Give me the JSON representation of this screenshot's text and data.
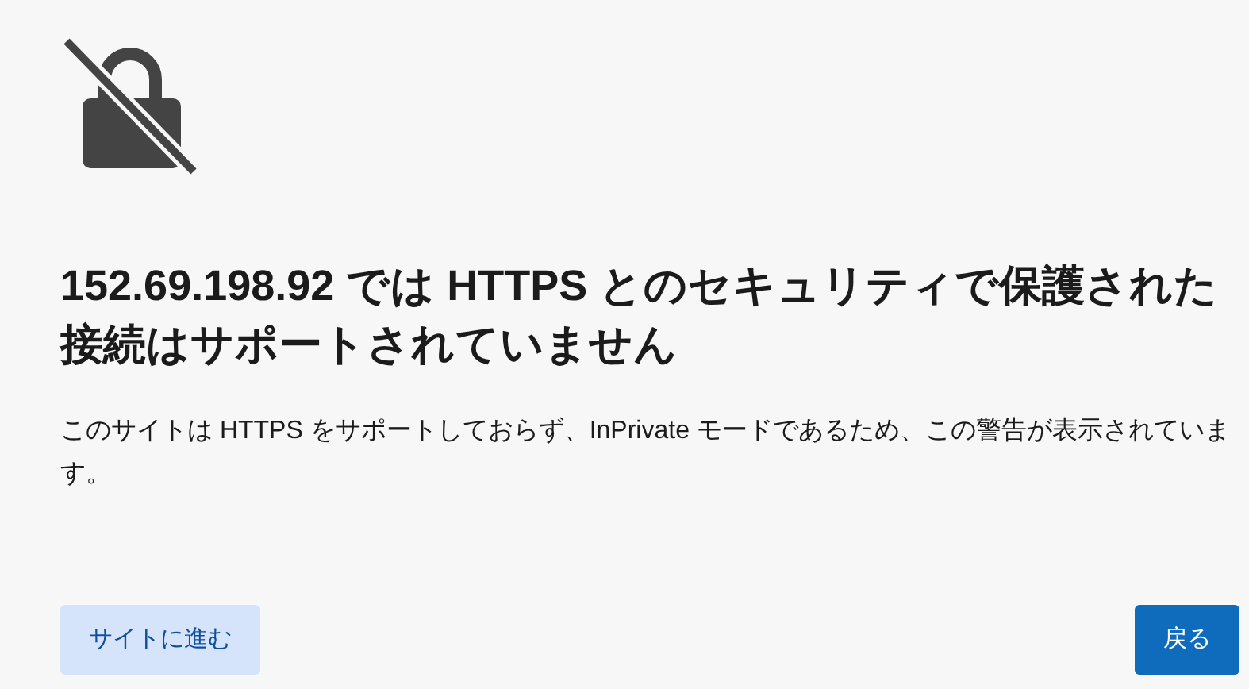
{
  "heading": "152.69.198.92 では HTTPS とのセキュリティで保護された接続はサポートされていません",
  "message": "このサイトは HTTPS をサポートしておらず、InPrivate モードであるため、この警告が表示されています。",
  "buttons": [
    {
      "label": "サイトに進む",
      "kind": "secondary"
    },
    {
      "label": "戻る",
      "kind": "primary"
    }
  ]
}
